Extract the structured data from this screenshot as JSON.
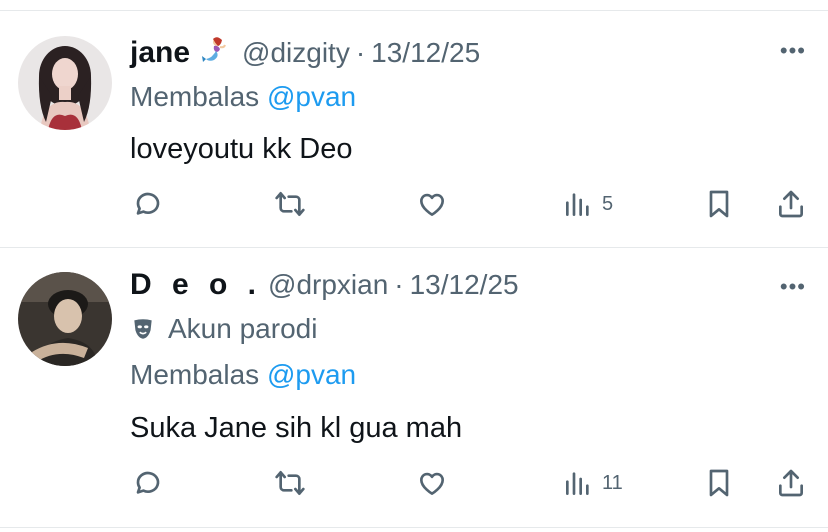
{
  "tweets": [
    {
      "display_name": "jane",
      "badge_icon": "mermaid-emoji",
      "handle": "@dizgity",
      "separator": "·",
      "date": "13/12/25",
      "more_label": "•••",
      "replying_prefix": "Membalas",
      "replying_to": "@pvan",
      "text": "loveyoutu kk Deo",
      "views": "5"
    },
    {
      "display_name": "D e o .",
      "handle": "@drpxian",
      "separator": "·",
      "date": "13/12/25",
      "more_label": "•••",
      "parody_icon": "theater-mask-icon",
      "parody_label": "Akun parodi",
      "replying_prefix": "Membalas",
      "replying_to": "@pvan",
      "text": "Suka Jane sih kl gua mah",
      "views": "11"
    }
  ],
  "colors": {
    "accent": "#1d9bf0",
    "secondary_text": "#536471",
    "primary_text": "#0f1419",
    "divider": "#e6e9eb"
  }
}
